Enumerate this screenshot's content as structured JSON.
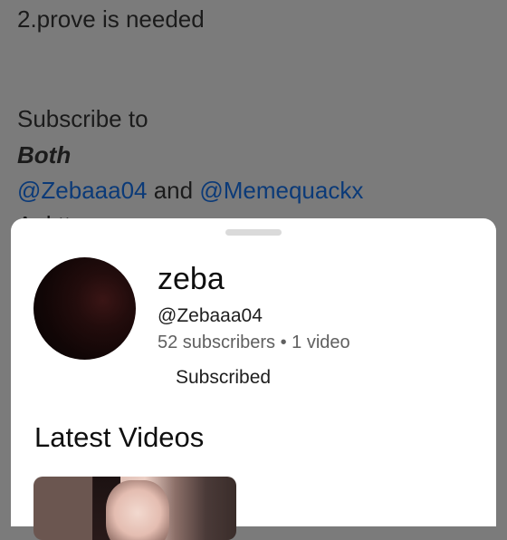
{
  "background_post": {
    "line1": "2.prove is needed",
    "line2": "Subscribe to",
    "line3": "Both",
    "mention1": "@Zebaaa04",
    "and_text": " and ",
    "mention2": "@Memequackx",
    "partial_line": "A  d   tt"
  },
  "channel_sheet": {
    "name": "zeba",
    "handle": "@Zebaaa04",
    "stats": "52 subscribers • 1 video",
    "subscribe_button_label": "Subscribed",
    "latest_videos_title": "Latest Videos"
  },
  "colors": {
    "overlay_background": "#7b7b7b",
    "sheet_background": "#ffffff",
    "mention_link": "#0b3a78",
    "secondary_text": "#606060"
  }
}
